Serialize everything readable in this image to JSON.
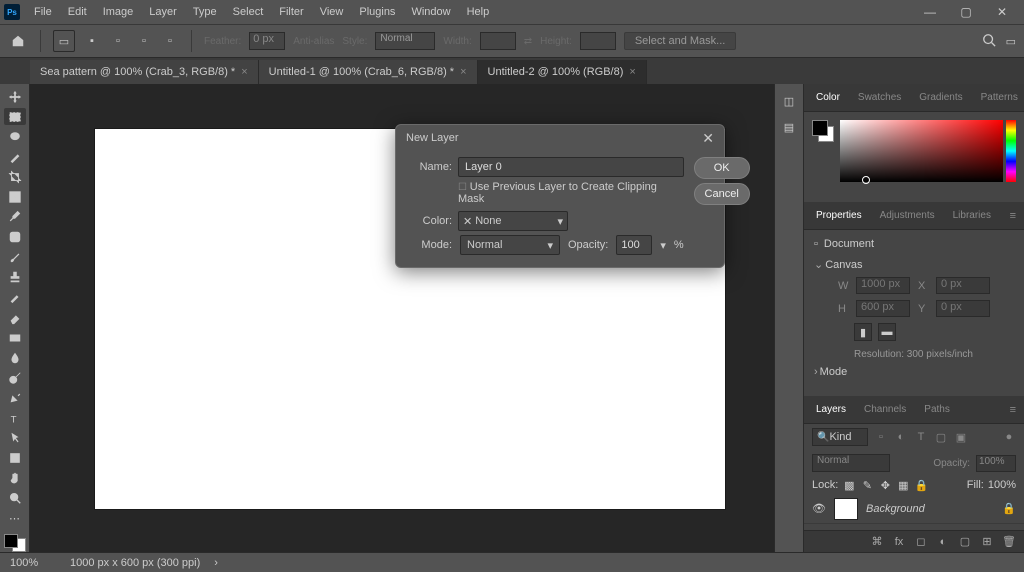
{
  "menu": {
    "items": [
      "File",
      "Edit",
      "Image",
      "Layer",
      "Type",
      "Select",
      "Filter",
      "View",
      "Plugins",
      "Window",
      "Help"
    ],
    "ps": "Ps"
  },
  "windowControls": {
    "min": "—",
    "max": "▢",
    "close": "✕"
  },
  "optionsBar": {
    "feather_label": "Feather:",
    "feather_value": "0 px",
    "antialias": "Anti-alias",
    "style": "Style:",
    "style_value": "Normal",
    "width": "Width:",
    "height": "Height:",
    "select_mask": "Select and Mask..."
  },
  "tabs": [
    {
      "label": "Sea pattern @ 100% (Crab_3, RGB/8) *",
      "active": false
    },
    {
      "label": "Untitled-1 @ 100% (Crab_6, RGB/8) *",
      "active": false
    },
    {
      "label": "Untitled-2 @ 100% (RGB/8)",
      "active": true
    }
  ],
  "dialog": {
    "title": "New Layer",
    "name_label": "Name:",
    "name_value": "Layer 0",
    "clip_label": "Use Previous Layer to Create Clipping Mask",
    "color_label": "Color:",
    "color_value": "None",
    "color_prefix": "✕",
    "mode_label": "Mode:",
    "mode_value": "Normal",
    "opacity_label": "Opacity:",
    "opacity_value": "100",
    "opacity_suffix": "%",
    "ok": "OK",
    "cancel": "Cancel"
  },
  "colorPanel": {
    "tabs": [
      "Color",
      "Swatches",
      "Gradients",
      "Patterns"
    ]
  },
  "propertiesPanel": {
    "tabs": [
      "Properties",
      "Adjustments",
      "Libraries"
    ],
    "doc": "Document",
    "canvas": "Canvas",
    "w": "W",
    "w_val": "1000 px",
    "x": "X",
    "x_val": "0 px",
    "h": "H",
    "h_val": "600 px",
    "y": "Y",
    "y_val": "0 px",
    "resolution": "Resolution: 300 pixels/inch",
    "mode": "Mode"
  },
  "layersPanel": {
    "tabs": [
      "Layers",
      "Channels",
      "Paths"
    ],
    "kind": "Kind",
    "blend": "Normal",
    "opacity_label": "Opacity:",
    "opacity_value": "100%",
    "lock": "Lock:",
    "fill_label": "Fill:",
    "fill_value": "100%",
    "layers": [
      {
        "name": "Background",
        "locked": true
      }
    ]
  },
  "status": {
    "zoom": "100%",
    "doc": "1000 px x 600 px (300 ppi)"
  }
}
